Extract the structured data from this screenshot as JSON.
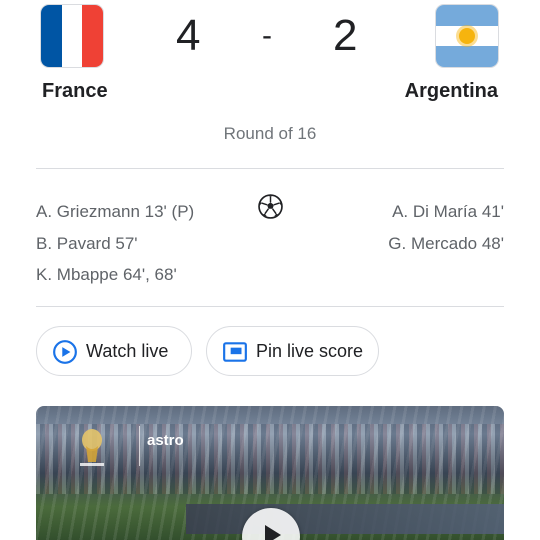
{
  "match": {
    "home": {
      "name": "France",
      "score": "4",
      "flag_colors": [
        "#0055a4",
        "#ffffff",
        "#ef4135"
      ],
      "scorers": [
        "A. Griezmann 13' (P)",
        "B. Pavard 57'",
        "K. Mbappe 64', 68'"
      ]
    },
    "away": {
      "name": "Argentina",
      "score": "2",
      "flag_colors": [
        "#75aadb",
        "#ffffff",
        "#f6b40e"
      ],
      "scorers": [
        "A. Di María 41'",
        "G. Mercado 48'"
      ]
    },
    "separator": "-",
    "round": "Round of 16",
    "goals_icon": "soccer-ball-icon"
  },
  "actions": {
    "watch_live": {
      "label": "Watch live",
      "icon": "play-circle-icon"
    },
    "pin_score": {
      "label": "Pin live score",
      "icon": "pin-window-icon"
    }
  },
  "video": {
    "broadcaster": "astro",
    "logo": "world-cup-logo-icon",
    "play_icon": "play-icon"
  },
  "colors": {
    "accent": "#1a73e8",
    "text": "#202124",
    "secondary_text": "#5f6368",
    "divider": "#dadce0"
  }
}
